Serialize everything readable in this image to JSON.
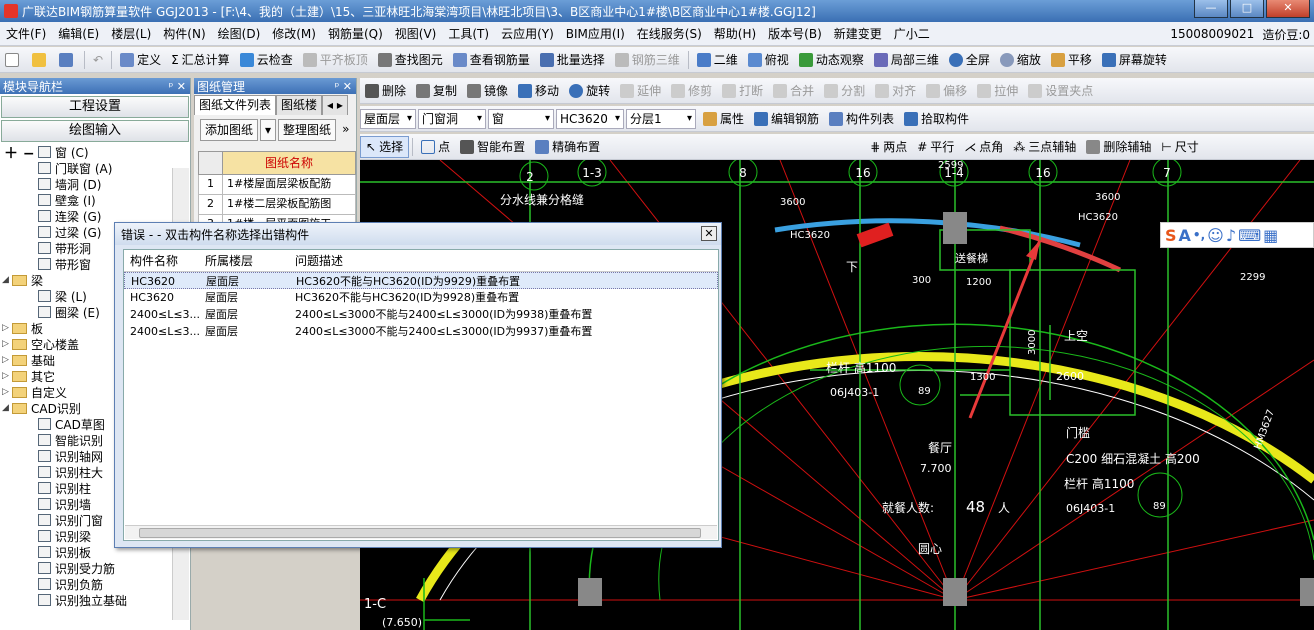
{
  "window": {
    "title": "广联达BIM钢筋算量软件 GGJ2013 - [F:\\4、我的（土建）\\15、三亚林旺北海棠湾项目\\林旺北项目\\3、B区商业中心1#楼\\B区商业中心1#楼.GGJ12]"
  },
  "menu": {
    "items": [
      "文件(F)",
      "编辑(E)",
      "楼层(L)",
      "构件(N)",
      "绘图(D)",
      "修改(M)",
      "钢筋量(Q)",
      "视图(V)",
      "工具(T)",
      "云应用(Y)",
      "BIM应用(I)",
      "在线服务(S)",
      "帮助(H)",
      "版本号(B)",
      "新建变更",
      "广小二"
    ],
    "phone": "15008009021",
    "price": "造价豆:0"
  },
  "toolbar1": {
    "define": "定义",
    "calc": "汇总计算",
    "cloud_check": "云检查",
    "level_plate": "平齐板顶",
    "find": "查找图元",
    "view_rebar": "查看钢筋量",
    "batch": "批量选择",
    "rebar3d": "钢筋三维",
    "view2d": "二维",
    "topview": "俯视",
    "dynamic": "动态观察",
    "local3d": "局部三维",
    "fullscreen": "全屏",
    "zoom": "缩放",
    "pan": "平移",
    "rotate": "屏幕旋转"
  },
  "toolbar2": {
    "delete": "删除",
    "copy": "复制",
    "mirror": "镜像",
    "move": "移动",
    "rotate": "旋转",
    "extend": "延伸",
    "trim": "修剪",
    "break": "打断",
    "merge": "合并",
    "split": "分割",
    "align": "对齐",
    "offset": "偏移",
    "stretch": "拉伸",
    "setpoint": "设置夹点"
  },
  "toolbar3": {
    "floor": "屋面层",
    "category": "门窗洞",
    "type": "窗",
    "member": "HC3620",
    "layer": "分层1",
    "attr": "属性",
    "edit_rebar": "编辑钢筋",
    "list": "构件列表",
    "pick": "拾取构件"
  },
  "toolbar4": {
    "select": "选择",
    "point": "点",
    "smart": "智能布置",
    "precise": "精确布置",
    "two_point": "两点",
    "parallel": "平行",
    "angle_point": "点角",
    "three_point": "三点辅轴",
    "del_aux": "删除辅轴",
    "ruler": "尺寸"
  },
  "nav": {
    "title": "模块导航栏",
    "project": "工程设置",
    "draw": "绘图输入",
    "tree": [
      {
        "label": "窗 (C)",
        "indent": 3
      },
      {
        "label": "门联窗 (A)",
        "indent": 3
      },
      {
        "label": "墙洞 (D)",
        "indent": 3
      },
      {
        "label": "壁龛 (I)",
        "indent": 3
      },
      {
        "label": "连梁 (G)",
        "indent": 3
      },
      {
        "label": "过梁 (G)",
        "indent": 3
      },
      {
        "label": "带形洞",
        "indent": 3
      },
      {
        "label": "带形窗",
        "indent": 3
      },
      {
        "label": "梁",
        "indent": 1,
        "folder": true,
        "open": true
      },
      {
        "label": "梁 (L)",
        "indent": 3
      },
      {
        "label": "圈梁 (E)",
        "indent": 3
      },
      {
        "label": "板",
        "indent": 1,
        "folder": true
      },
      {
        "label": "空心楼盖",
        "indent": 1,
        "folder": true
      },
      {
        "label": "基础",
        "indent": 1,
        "folder": true
      },
      {
        "label": "其它",
        "indent": 1,
        "folder": true
      },
      {
        "label": "自定义",
        "indent": 1,
        "folder": true
      },
      {
        "label": "CAD识别",
        "indent": 1,
        "folder": true,
        "open": true
      },
      {
        "label": "CAD草图",
        "indent": 3
      },
      {
        "label": "智能识别",
        "indent": 3
      },
      {
        "label": "识别轴网",
        "indent": 3
      },
      {
        "label": "识别柱大",
        "indent": 3
      },
      {
        "label": "识别柱",
        "indent": 3
      },
      {
        "label": "识别墙",
        "indent": 3
      },
      {
        "label": "识别门窗",
        "indent": 3
      },
      {
        "label": "识别梁",
        "indent": 3
      },
      {
        "label": "识别板",
        "indent": 3
      },
      {
        "label": "识别受力筋",
        "indent": 3
      },
      {
        "label": "识别负筋",
        "indent": 3
      },
      {
        "label": "识别独立基础",
        "indent": 3
      }
    ]
  },
  "drawings": {
    "title": "图纸管理",
    "tab1": "图纸文件列表",
    "tab2": "图纸楼",
    "add": "添加图纸",
    "arrange": "整理图纸",
    "col_name": "图纸名称",
    "rows": [
      {
        "no": "1",
        "name": "1#楼屋面层梁板配筋"
      },
      {
        "no": "2",
        "name": "1#楼二层梁板配筋图"
      },
      {
        "no": "3",
        "name": "1#楼一层平面图施工"
      }
    ]
  },
  "dialog": {
    "title": "错误 - - 双击构件名称选择出错构件",
    "col1": "构件名称",
    "col2": "所属楼层",
    "col3": "问题描述",
    "rows": [
      {
        "name": "HC3620",
        "floor": "屋面层",
        "desc": "HC3620不能与HC3620(ID为9929)重叠布置"
      },
      {
        "name": "HC3620",
        "floor": "屋面层",
        "desc": "HC3620不能与HC3620(ID为9928)重叠布置"
      },
      {
        "name": "2400≤L≤3...",
        "floor": "屋面层",
        "desc": "2400≤L≤3000不能与2400≤L≤3000(ID为9938)重叠布置"
      },
      {
        "name": "2400≤L≤3...",
        "floor": "屋面层",
        "desc": "2400≤L≤3000不能与2400≤L≤3000(ID为9937)重叠布置"
      }
    ]
  },
  "cad": {
    "labels": [
      "2",
      "1-3",
      "8",
      "16",
      "1-4",
      "16",
      "7",
      "分水线兼分格缝",
      "3600",
      "3600",
      "HC3620",
      "HC3620",
      "送餐梯",
      "300",
      "1200",
      "2299",
      "下",
      "3000",
      "上空",
      "栏杆  高1100",
      "06J403-1",
      "89",
      "1300",
      "2600",
      "门槛",
      "C200  细石混凝土 高200",
      "餐厅",
      "7.700",
      "栏杆  高1100",
      "06J403-1",
      "89",
      "就餐人数:",
      "48",
      "人",
      "HM3627",
      "圆心",
      "1-C",
      "(7.650)",
      "2599"
    ]
  },
  "colors": {
    "cad_bg": "#000000",
    "accent": "#3a6fb3"
  }
}
